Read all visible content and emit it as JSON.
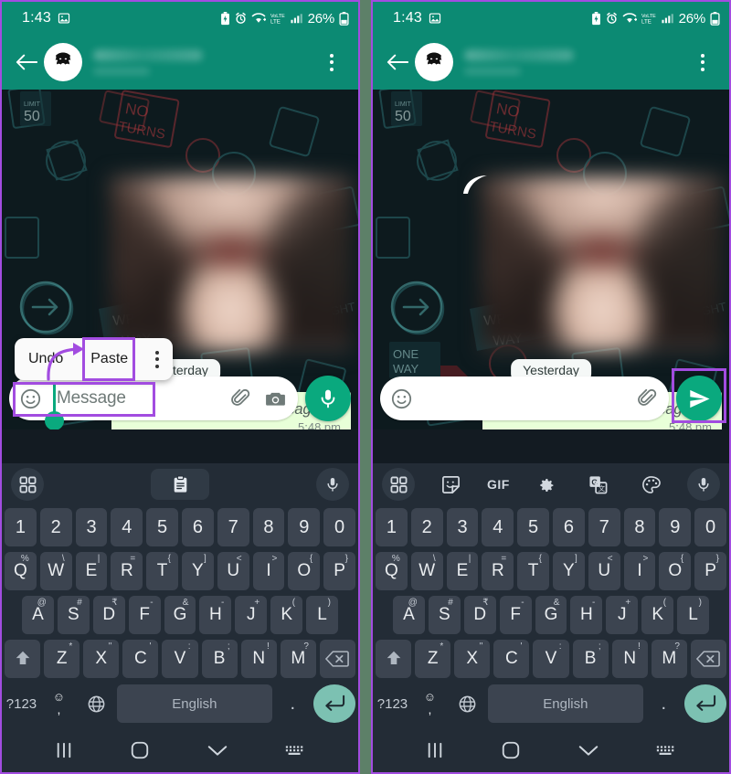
{
  "meta": {
    "accent_purple": "#a24ce0",
    "whatsapp_green": "#0c8a73",
    "send_green": "#0aa97e",
    "bubble_green": "#e8ffd8",
    "keyboard_bg": "#232c36",
    "key_bg": "#3c4450"
  },
  "status_bar": {
    "time": "1:43",
    "battery_percent": "26%",
    "icons": [
      "photo-icon",
      "battery-saver-icon",
      "alarm-icon",
      "wifi-icon",
      "volte-icon",
      "signal-icon",
      "battery-icon"
    ],
    "volte_label": "VoLTE"
  },
  "app_bar": {
    "back_icon": "back-arrow-icon",
    "avatar_icon": "batman-avatar-icon",
    "contact_name": "",
    "menu_icon": "overflow-menu-icon"
  },
  "chat": {
    "date_divider": "Yesterday",
    "message": {
      "text": "You deleted this message",
      "time": "5:48 pm",
      "icon": "blocked-icon"
    },
    "attachment_alt": "blurred-photo"
  },
  "composer": {
    "placeholder": "Message",
    "emoji_icon": "emoji-icon",
    "attach_icon": "paperclip-icon",
    "camera_icon": "camera-icon",
    "mic_icon": "microphone-icon",
    "send_icon": "send-icon"
  },
  "context_menu": {
    "undo": "Undo",
    "paste": "Paste",
    "more_icon": "overflow-menu-icon"
  },
  "annotations": {
    "paste_highlight": "paste-highlight-box",
    "message_highlight": "message-field-highlight-box",
    "send_highlight": "send-button-highlight-box",
    "pointer_arrow": "annotation-arrow",
    "forward_arrow": "forward-arrow-icon"
  },
  "keyboard": {
    "toolbar_left": [
      "grid-icon",
      "clipboard-icon",
      "microphone-icon"
    ],
    "toolbar_right": [
      "grid-icon",
      "sticker-icon",
      "gif-icon",
      "settings-gear-icon",
      "translate-icon",
      "theme-palette-icon",
      "microphone-icon"
    ],
    "gif_label": "GIF",
    "rows": {
      "numbers": [
        "1",
        "2",
        "3",
        "4",
        "5",
        "6",
        "7",
        "8",
        "9",
        "0"
      ],
      "top": [
        {
          "main": "Q",
          "sup": "%"
        },
        {
          "main": "W",
          "sup": "\\"
        },
        {
          "main": "E",
          "sup": "|"
        },
        {
          "main": "R",
          "sup": "="
        },
        {
          "main": "T",
          "sup": "{"
        },
        {
          "main": "Y",
          "sup": "]"
        },
        {
          "main": "U",
          "sup": "<"
        },
        {
          "main": "I",
          "sup": ">"
        },
        {
          "main": "O",
          "sup": "{"
        },
        {
          "main": "P",
          "sup": "}"
        }
      ],
      "home": [
        {
          "main": "A",
          "sup": "@"
        },
        {
          "main": "S",
          "sup": "#"
        },
        {
          "main": "D",
          "sup": "₹"
        },
        {
          "main": "F",
          "sup": "-"
        },
        {
          "main": "G",
          "sup": "&"
        },
        {
          "main": "H",
          "sup": "-"
        },
        {
          "main": "J",
          "sup": "+"
        },
        {
          "main": "K",
          "sup": "("
        },
        {
          "main": "L",
          "sup": ")"
        }
      ],
      "bottom": [
        {
          "main": "Z",
          "sup": "*"
        },
        {
          "main": "X",
          "sup": "\""
        },
        {
          "main": "C",
          "sup": "'"
        },
        {
          "main": "V",
          "sup": ":"
        },
        {
          "main": "B",
          "sup": ";"
        },
        {
          "main": "N",
          "sup": "!"
        },
        {
          "main": "M",
          "sup": "?"
        }
      ],
      "shift_icon": "shift-icon",
      "backspace_icon": "backspace-icon"
    },
    "function_row": {
      "symbols": "?123",
      "emoji_top": "☺",
      "emoji_bottom": ",",
      "globe_icon": "language-globe-icon",
      "space_label": "English",
      "period": ".",
      "enter_icon": "enter-icon"
    }
  },
  "nav_bar": {
    "recents_icon": "recents-icon",
    "home_icon": "home-icon",
    "hide_keyboard_icon": "chevron-down-icon",
    "switch_keyboard_icon": "keyboard-switch-icon"
  }
}
